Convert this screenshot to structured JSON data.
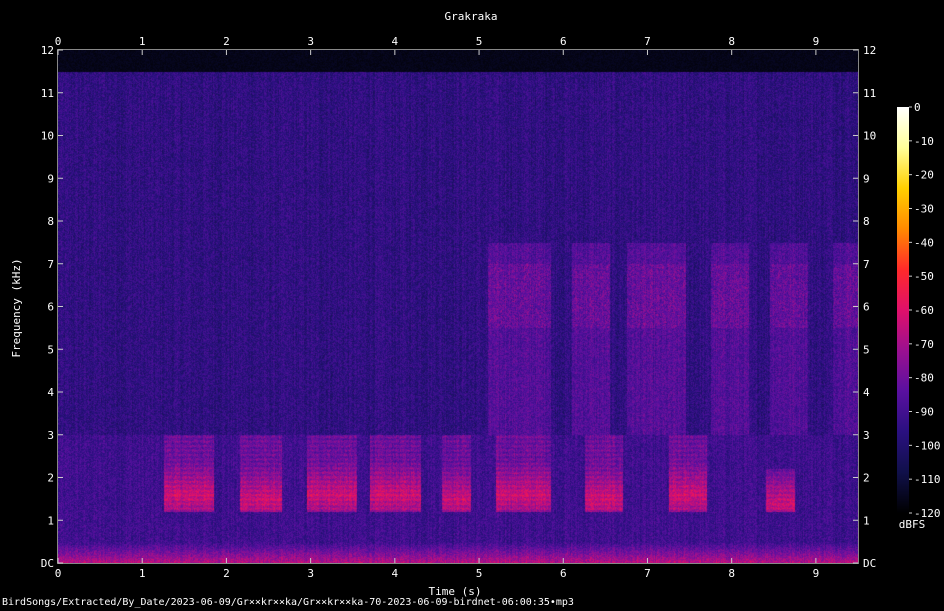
{
  "chart_data": {
    "type": "heatmap",
    "title": "Grakraka",
    "xlabel": "Time (s)",
    "ylabel": "Frequency (kHz)",
    "xlim": [
      0,
      9.5
    ],
    "ylim": [
      0,
      12
    ],
    "x_ticks": [
      "0",
      "1",
      "2",
      "3",
      "4",
      "5",
      "6",
      "7",
      "8",
      "9"
    ],
    "y_ticks": [
      "DC",
      "1",
      "2",
      "3",
      "4",
      "5",
      "6",
      "7",
      "8",
      "9",
      "10",
      "11",
      "12"
    ],
    "colorbar": {
      "label": "dBFS",
      "ticks": [
        "0",
        "-10",
        "-20",
        "-30",
        "-40",
        "-50",
        "-60",
        "-70",
        "-80",
        "-90",
        "-100",
        "-110",
        "-120"
      ],
      "range": [
        -120,
        0
      ],
      "colors": [
        "#000000",
        "#10104a",
        "#2a1080",
        "#5a10a0",
        "#9a1090",
        "#e0106a",
        "#ff2a2a",
        "#ff8a00",
        "#ffd000",
        "#ffff9a",
        "#ffffff"
      ]
    },
    "background_level_dbfs": -95,
    "noise_top_khz": 11.5,
    "calls": [
      {
        "start": 1.25,
        "end": 1.85,
        "low_khz": 1.2,
        "high_khz": 3.0,
        "peak_khz": 1.6
      },
      {
        "start": 2.15,
        "end": 2.65,
        "low_khz": 1.2,
        "high_khz": 3.0,
        "peak_khz": 1.5
      },
      {
        "start": 2.95,
        "end": 3.55,
        "low_khz": 1.2,
        "high_khz": 3.0,
        "peak_khz": 1.6
      },
      {
        "start": 3.7,
        "end": 4.3,
        "low_khz": 1.2,
        "high_khz": 3.0,
        "peak_khz": 1.6
      },
      {
        "start": 4.55,
        "end": 4.9,
        "low_khz": 1.2,
        "high_khz": 3.0,
        "peak_khz": 1.5
      },
      {
        "start": 5.2,
        "end": 5.85,
        "low_khz": 1.2,
        "high_khz": 3.0,
        "peak_khz": 1.6
      },
      {
        "start": 6.25,
        "end": 6.7,
        "low_khz": 1.2,
        "high_khz": 3.0,
        "peak_khz": 1.5
      },
      {
        "start": 7.25,
        "end": 7.7,
        "low_khz": 1.2,
        "high_khz": 3.0,
        "peak_khz": 1.6
      },
      {
        "start": 8.4,
        "end": 8.75,
        "low_khz": 1.2,
        "high_khz": 2.2,
        "peak_khz": 1.4
      }
    ],
    "broadband_bursts": [
      {
        "start": 5.1,
        "end": 5.85,
        "low_khz": 3.0,
        "high_khz": 7.5
      },
      {
        "start": 6.1,
        "end": 6.55,
        "low_khz": 3.0,
        "high_khz": 7.5
      },
      {
        "start": 6.75,
        "end": 7.45,
        "low_khz": 3.0,
        "high_khz": 7.5
      },
      {
        "start": 7.75,
        "end": 8.2,
        "low_khz": 3.0,
        "high_khz": 7.5
      },
      {
        "start": 8.45,
        "end": 8.9,
        "low_khz": 3.0,
        "high_khz": 7.5
      },
      {
        "start": 9.2,
        "end": 9.5,
        "low_khz": 3.0,
        "high_khz": 7.5
      }
    ]
  },
  "footer_path": "BirdSongs/Extracted/By_Date/2023-06-09/Gr××kr××ka/Gr××kr××ka-70-2023-06-09-birdnet-06:00:35•mp3"
}
